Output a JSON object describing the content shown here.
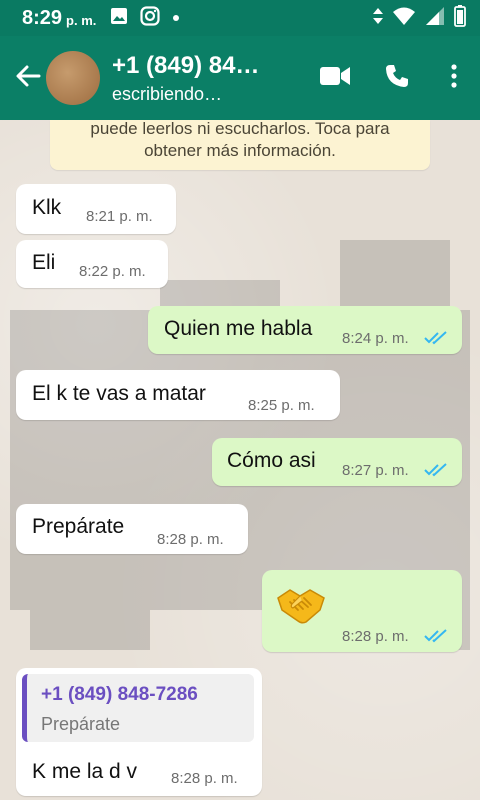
{
  "status_bar": {
    "time": "8:29",
    "ampm": "p. m."
  },
  "header": {
    "contact_name": "+1 (849) 84…",
    "contact_status": "escribiendo…"
  },
  "notice": {
    "line1": "puede leerlos ni escucharlos. Toca para",
    "line2": "obtener más información."
  },
  "messages": [
    {
      "direction": "in",
      "text": "Klk",
      "time": "8:21 p. m."
    },
    {
      "direction": "in",
      "text": "Eli",
      "time": "8:22 p. m."
    },
    {
      "direction": "out",
      "text": "Quien me habla",
      "time": "8:24 p. m.",
      "status": "read"
    },
    {
      "direction": "in",
      "text": "El k te vas a matar",
      "time": "8:25 p. m."
    },
    {
      "direction": "out",
      "text": "Cómo asi",
      "time": "8:27 p. m.",
      "status": "read"
    },
    {
      "direction": "in",
      "text": "Prepárate",
      "time": "8:28 p. m."
    },
    {
      "direction": "out",
      "text": "🤝",
      "time": "8:28 p. m.",
      "status": "read"
    },
    {
      "direction": "in",
      "text": "K me la d v",
      "time": "8:28 p. m.",
      "quoted": {
        "author": "+1 (849) 848-7286",
        "text": "Prepárate"
      }
    }
  ],
  "colors": {
    "header": "#0b7f66",
    "outgoing_bubble": "#dcf8c6",
    "read_ticks": "#34b7f1",
    "quote_accent": "#6b4fc1"
  }
}
